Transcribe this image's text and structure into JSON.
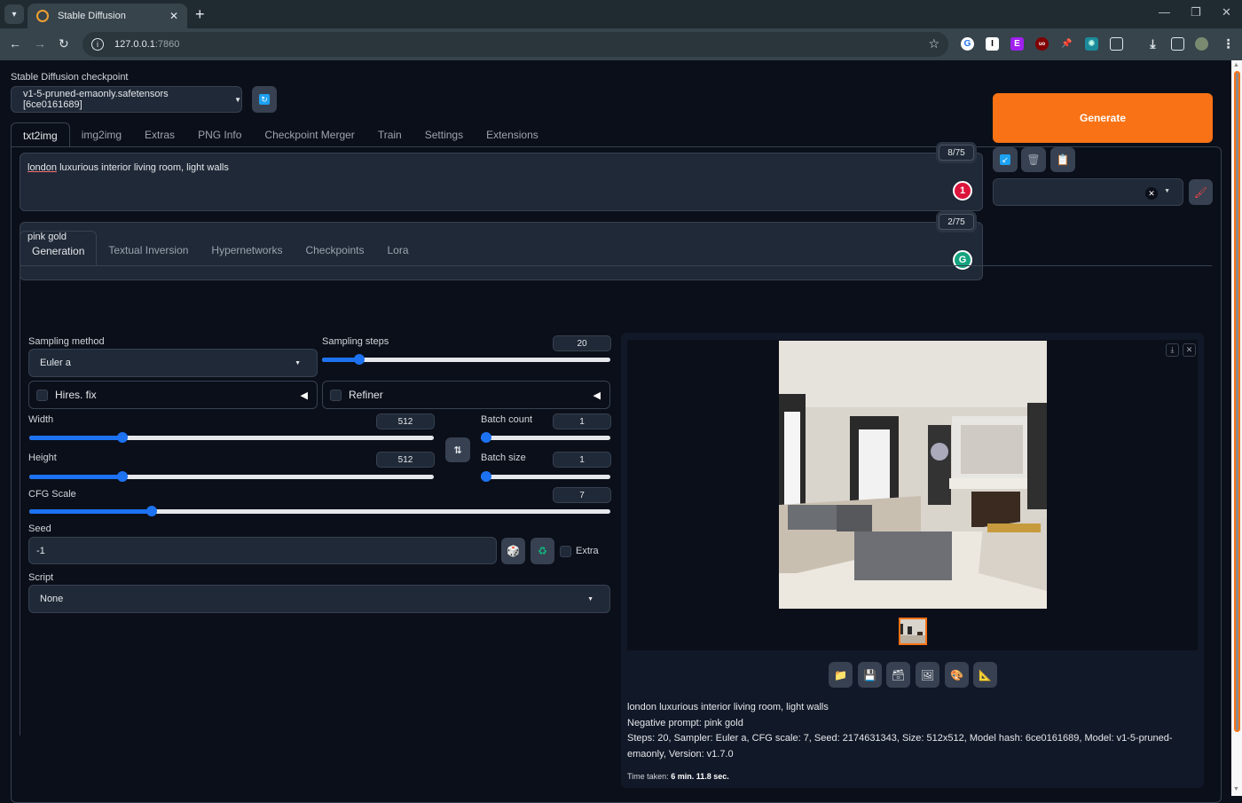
{
  "browser": {
    "tab_title": "Stable Diffusion",
    "url_host": "127.0.0.1",
    "url_port": ":7860",
    "extensions": [
      "grammarly-icon",
      "instapaper-icon",
      "e-extension-icon",
      "ublock-icon",
      "pin-icon",
      "ai-extension-icon",
      "extensions-puzzle-icon"
    ]
  },
  "checkpoint": {
    "label": "Stable Diffusion checkpoint",
    "value": "v1-5-pruned-emaonly.safetensors [6ce0161689]"
  },
  "main_tabs": [
    {
      "label": "txt2img",
      "active": true
    },
    {
      "label": "img2img"
    },
    {
      "label": "Extras"
    },
    {
      "label": "PNG Info"
    },
    {
      "label": "Checkpoint Merger"
    },
    {
      "label": "Train"
    },
    {
      "label": "Settings"
    },
    {
      "label": "Extensions"
    }
  ],
  "prompt": {
    "value_first": "london",
    "value_rest": " luxurious interior living room, light walls",
    "token_count": "8/75",
    "badge": "1"
  },
  "negative_prompt": {
    "value": "pink gold",
    "token_count": "2/75",
    "badge": "G"
  },
  "generate_label": "Generate",
  "styles_value": "",
  "sub_tabs": [
    {
      "label": "Generation",
      "active": true
    },
    {
      "label": "Textual Inversion"
    },
    {
      "label": "Hypernetworks"
    },
    {
      "label": "Checkpoints"
    },
    {
      "label": "Lora"
    }
  ],
  "generation": {
    "sampling_method_label": "Sampling method",
    "sampling_method": "Euler a",
    "sampling_steps_label": "Sampling steps",
    "sampling_steps": "20",
    "sampling_steps_fraction": 0.13,
    "hires_label": "Hires. fix",
    "refiner_label": "Refiner",
    "width_label": "Width",
    "width": "512",
    "width_fraction": 0.23,
    "height_label": "Height",
    "height": "512",
    "height_fraction": 0.23,
    "batch_count_label": "Batch count",
    "batch_count": "1",
    "batch_count_fraction": 0.0,
    "batch_size_label": "Batch size",
    "batch_size": "1",
    "batch_size_fraction": 0.0,
    "cfg_label": "CFG Scale",
    "cfg": "7",
    "cfg_fraction": 0.21,
    "seed_label": "Seed",
    "seed": "-1",
    "extra_label": "Extra",
    "script_label": "Script",
    "script": "None"
  },
  "output": {
    "info_prompt": "london luxurious interior living room, light walls",
    "info_negative": "Negative prompt: pink gold",
    "info_params": "Steps: 20, Sampler: Euler a, CFG scale: 7, Seed: 2174631343, Size: 512x512, Model hash: 6ce0161689, Model: v1-5-pruned-emaonly, Version: v1.7.0",
    "time_label": "Time taken:",
    "time_value": "6 min. 11.8 sec."
  }
}
